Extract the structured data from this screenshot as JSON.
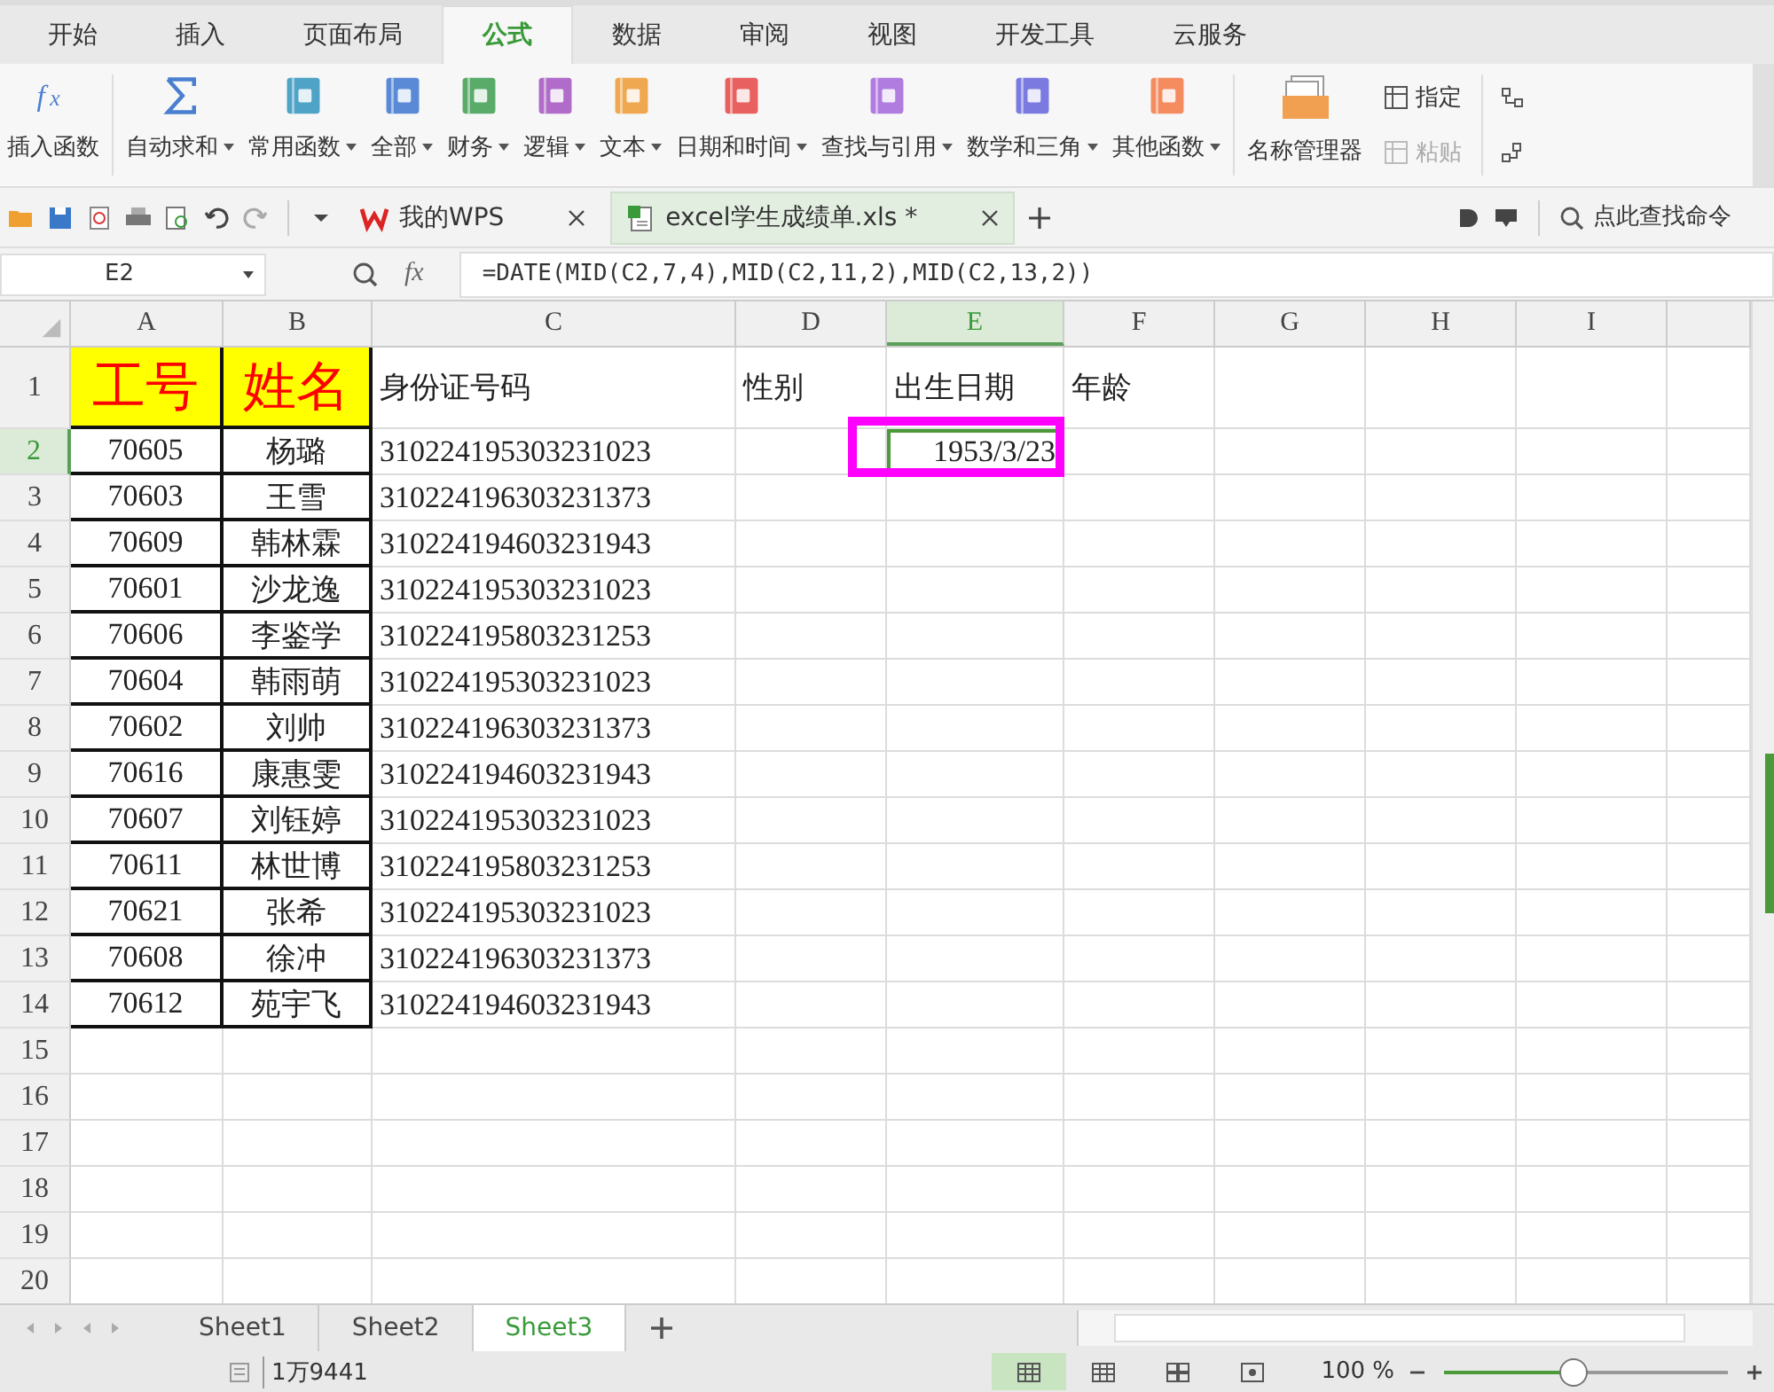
{
  "menu_tabs": [
    {
      "label": "开始",
      "selected": false
    },
    {
      "label": "插入",
      "selected": false
    },
    {
      "label": "页面布局",
      "selected": false
    },
    {
      "label": "公式",
      "selected": true
    },
    {
      "label": "数据",
      "selected": false
    },
    {
      "label": "审阅",
      "selected": false
    },
    {
      "label": "视图",
      "selected": false
    },
    {
      "label": "开发工具",
      "selected": false
    },
    {
      "label": "云服务",
      "selected": false
    }
  ],
  "ribbon": [
    {
      "label": "插入函数",
      "kind": "fx",
      "dropdown": false
    },
    {
      "label": "自动求和",
      "kind": "sigma",
      "dropdown": true
    },
    {
      "label": "常用函数",
      "kind": "book",
      "color": "#4fa3c7",
      "dropdown": true
    },
    {
      "label": "全部",
      "kind": "book",
      "color": "#5a8ad6",
      "dropdown": true
    },
    {
      "label": "财务",
      "kind": "book",
      "color": "#5aab6a",
      "dropdown": true
    },
    {
      "label": "逻辑",
      "kind": "book",
      "color": "#b06cc8",
      "dropdown": true
    },
    {
      "label": "文本",
      "kind": "book",
      "color": "#f0a850",
      "dropdown": true
    },
    {
      "label": "日期和时间",
      "kind": "book",
      "color": "#e86060",
      "dropdown": true
    },
    {
      "label": "查找与引用",
      "kind": "book",
      "color": "#b07ce0",
      "dropdown": true
    },
    {
      "label": "数学和三角",
      "kind": "book",
      "color": "#7a7ae0",
      "dropdown": true
    },
    {
      "label": "其他函数",
      "kind": "book",
      "color": "#f48c60",
      "dropdown": true
    }
  ],
  "name_manager": {
    "label": "名称管理器"
  },
  "small_buttons": [
    {
      "label": "指定",
      "disabled": false
    },
    {
      "label": "粘贴",
      "disabled": true
    }
  ],
  "doc_tabs": [
    {
      "label": "我的WPS",
      "kind": "wps",
      "selected": false
    },
    {
      "label": "excel学生成绩单.xls *",
      "kind": "sheet",
      "selected": true
    }
  ],
  "search": {
    "placeholder": "点此查找命令"
  },
  "formula_bar": {
    "name_box": "E2",
    "function_label": "fx",
    "formula": "=DATE(MID(C2,7,4),MID(C2,11,2),MID(C2,13,2))"
  },
  "columns": [
    {
      "label": "A",
      "selected": false
    },
    {
      "label": "B",
      "selected": false
    },
    {
      "label": "C",
      "selected": false
    },
    {
      "label": "D",
      "selected": false
    },
    {
      "label": "E",
      "selected": true
    },
    {
      "label": "F",
      "selected": false
    },
    {
      "label": "G",
      "selected": false
    },
    {
      "label": "H",
      "selected": false
    },
    {
      "label": "I",
      "selected": false
    }
  ],
  "rows": [
    {
      "number": "1",
      "kind": "header",
      "selected": false,
      "bordered": true,
      "cells": {
        "A": "工号",
        "B": "姓名",
        "C": "身份证号码",
        "D": "性别",
        "E": "出生日期",
        "F": "年龄"
      }
    },
    {
      "number": "2",
      "kind": "data",
      "selected": true,
      "bordered": true,
      "annotated": true,
      "cells": {
        "A": "70605",
        "B": "杨璐",
        "C": "310224195303231023",
        "E": "1953/3/23"
      }
    },
    {
      "number": "3",
      "kind": "data",
      "selected": false,
      "bordered": true,
      "cells": {
        "A": "70603",
        "B": "王雪",
        "C": "310224196303231373"
      }
    },
    {
      "number": "4",
      "kind": "data",
      "selected": false,
      "bordered": true,
      "cells": {
        "A": "70609",
        "B": "韩林霖",
        "C": "310224194603231943"
      }
    },
    {
      "number": "5",
      "kind": "data",
      "selected": false,
      "bordered": true,
      "cells": {
        "A": "70601",
        "B": "沙龙逸",
        "C": "310224195303231023"
      }
    },
    {
      "number": "6",
      "kind": "data",
      "selected": false,
      "bordered": true,
      "cells": {
        "A": "70606",
        "B": "李鉴学",
        "C": "310224195803231253"
      }
    },
    {
      "number": "7",
      "kind": "data",
      "selected": false,
      "bordered": true,
      "cells": {
        "A": "70604",
        "B": "韩雨萌",
        "C": "310224195303231023"
      }
    },
    {
      "number": "8",
      "kind": "data",
      "selected": false,
      "bordered": true,
      "cells": {
        "A": "70602",
        "B": "刘帅",
        "C": "310224196303231373"
      }
    },
    {
      "number": "9",
      "kind": "data",
      "selected": false,
      "bordered": true,
      "cells": {
        "A": "70616",
        "B": "康惠雯",
        "C": "310224194603231943"
      }
    },
    {
      "number": "10",
      "kind": "data",
      "selected": false,
      "bordered": true,
      "cells": {
        "A": "70607",
        "B": "刘钰婷",
        "C": "310224195303231023"
      }
    },
    {
      "number": "11",
      "kind": "data",
      "selected": false,
      "bordered": true,
      "cells": {
        "A": "70611",
        "B": "林世博",
        "C": "310224195803231253"
      }
    },
    {
      "number": "12",
      "kind": "data",
      "selected": false,
      "bordered": true,
      "cells": {
        "A": "70621",
        "B": "张希",
        "C": "310224195303231023"
      }
    },
    {
      "number": "13",
      "kind": "data",
      "selected": false,
      "bordered": true,
      "cells": {
        "A": "70608",
        "B": "徐冲",
        "C": "310224196303231373"
      }
    },
    {
      "number": "14",
      "kind": "data",
      "selected": false,
      "bordered": true,
      "cells": {
        "A": "70612",
        "B": "苑宇飞",
        "C": "310224194603231943"
      }
    },
    {
      "number": "15",
      "kind": "data",
      "selected": false,
      "bordered": false,
      "cells": {}
    },
    {
      "number": "16",
      "kind": "data",
      "selected": false,
      "bordered": false,
      "cells": {}
    },
    {
      "number": "17",
      "kind": "data",
      "selected": false,
      "bordered": false,
      "cells": {}
    },
    {
      "number": "18",
      "kind": "data",
      "selected": false,
      "bordered": false,
      "cells": {}
    },
    {
      "number": "19",
      "kind": "data",
      "selected": false,
      "bordered": false,
      "cells": {}
    },
    {
      "number": "20",
      "kind": "data",
      "selected": false,
      "bordered": false,
      "cells": {}
    }
  ],
  "sheet_tabs": [
    {
      "label": "Sheet1",
      "selected": false
    },
    {
      "label": "Sheet2",
      "selected": false
    },
    {
      "label": "Sheet3",
      "selected": true
    }
  ],
  "status_bar": {
    "count": "1万9441",
    "views": [
      {
        "kind": "normal",
        "selected": true
      },
      {
        "kind": "page",
        "selected": false
      },
      {
        "kind": "split",
        "selected": false
      },
      {
        "kind": "read",
        "selected": false
      }
    ],
    "zoom": "100 %",
    "zoom_slider": {
      "level": 0.45
    }
  }
}
